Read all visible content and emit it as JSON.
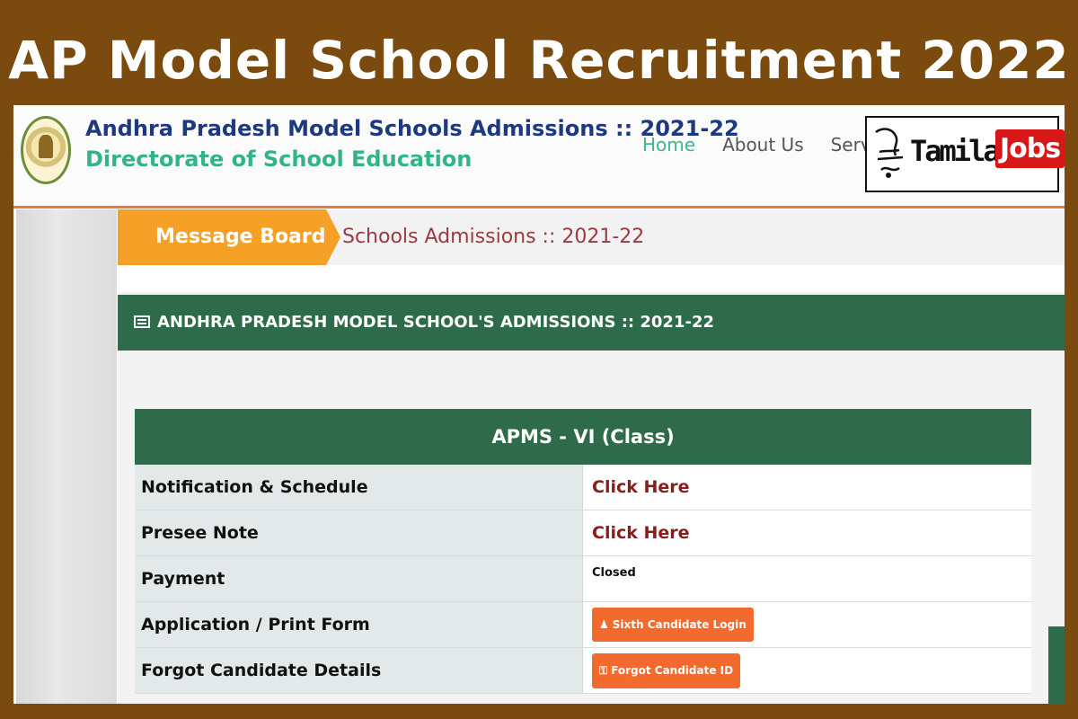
{
  "banner": {
    "title": "AP Model School Recruitment 2022"
  },
  "header": {
    "title_line1": "Andhra Pradesh Model Schools Admissions :: 2021-22",
    "title_line2": "Directorate of School Education",
    "nav": {
      "home": "Home",
      "about": "About Us",
      "services": "Service"
    }
  },
  "watermark": {
    "tamilan": "Tamilan",
    "jobs": "Jobs"
  },
  "breadcrumb": {
    "active": "Message Board",
    "current": "Schools Admissions :: 2021-22"
  },
  "panel": {
    "heading": "ANDHRA PRADESH MODEL SCHOOL'S ADMISSIONS :: 2021-22"
  },
  "table": {
    "heading": "APMS - VI (Class)",
    "rows": [
      {
        "label": "Notification & Schedule",
        "value": "Click Here"
      },
      {
        "label": "Presee Note",
        "value": "Click Here"
      },
      {
        "label": "Payment",
        "value": "Closed"
      },
      {
        "label": "Application / Print Form",
        "value": "Sixth Candidate Login"
      },
      {
        "label": "Forgot Candidate Details",
        "value": "Forgot Candidate ID"
      }
    ]
  },
  "colors": {
    "frame": "#7a4a0e",
    "green": "#2e6b4b",
    "orange": "#f5a128",
    "button": "#f26a2e"
  },
  "icons": [
    "emblem-icon",
    "newspaper-icon",
    "user-icon",
    "key-icon"
  ]
}
